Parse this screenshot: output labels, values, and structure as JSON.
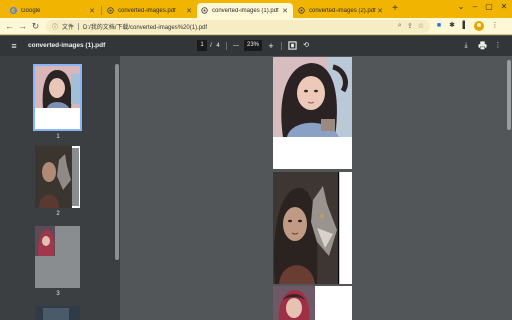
{
  "tabs": [
    {
      "label": "Google",
      "favicon": "google-g-icon"
    },
    {
      "label": "converted-images.pdf",
      "favicon": "globe-icon"
    },
    {
      "label": "converted-images (1).pdf",
      "favicon": "globe-icon"
    },
    {
      "label": "converted-images (2).pdf",
      "favicon": "globe-icon"
    }
  ],
  "omnibox": {
    "info": "文件",
    "url": "D:/我的文档/下载/converted-images%20(1).pdf"
  },
  "pdf_toolbar": {
    "title": "converted-images (1).pdf",
    "current_page": "1",
    "page_sep": "/",
    "total_pages": "4",
    "zoom": "23%",
    "zoom_out": "—",
    "zoom_in": "+"
  },
  "thumbnails": [
    {
      "number": "1"
    },
    {
      "number": "2"
    },
    {
      "number": "3"
    }
  ],
  "colors": {
    "tab_bar": "#f1b400",
    "toolbar": "#fff8d6",
    "pdf_toolbar": "#323639",
    "sidebar": "#3c3f42",
    "viewer_bg": "#525659",
    "selected_thumb": "#8ab4f8"
  }
}
